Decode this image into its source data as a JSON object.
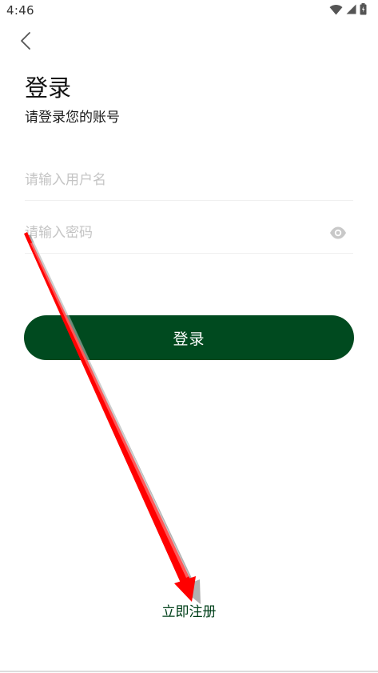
{
  "status_bar": {
    "time": "4:46",
    "icons": [
      "wifi-icon",
      "signal-icon",
      "battery-icon"
    ]
  },
  "nav": {
    "back_icon": "chevron-left-icon"
  },
  "header": {
    "title": "登录",
    "subtitle": "请登录您的账号"
  },
  "form": {
    "username_placeholder": "请输入用户名",
    "username_value": "",
    "password_placeholder": "请输入密码",
    "password_value": "",
    "password_toggle_icon": "eye-icon",
    "login_label": "登录"
  },
  "footer": {
    "register_label": "立即注册"
  },
  "colors": {
    "primary": "#004a1f",
    "link": "#00401a",
    "placeholder": "#c4c4c4",
    "annotation_arrow": "#ff0000"
  }
}
